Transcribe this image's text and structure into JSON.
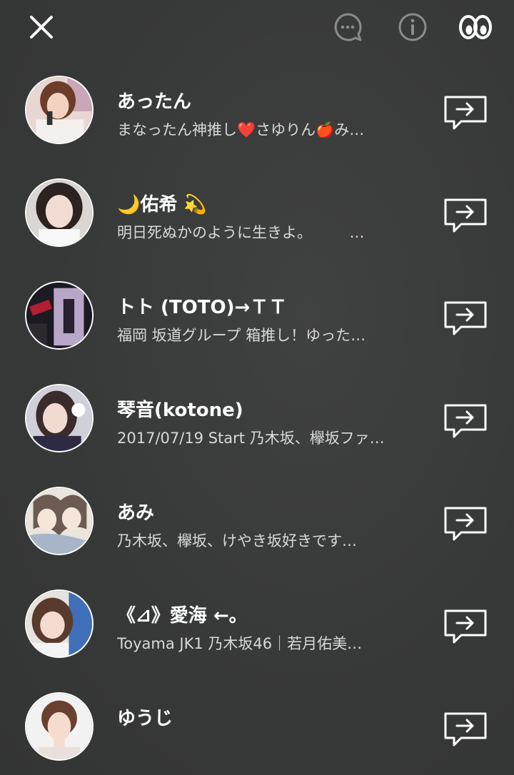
{
  "topbar": {
    "icons": [
      "close-icon",
      "chat-bubble-icon",
      "info-icon",
      "eyes-icon"
    ]
  },
  "friends": [
    {
      "name": "あったん",
      "status": "まなったん神推し❤️さゆりん🍎み…",
      "avatar": "avatar-1"
    },
    {
      "name": "🌙佑希 💫",
      "status": "明日死ぬかのように生きよ。　　　…",
      "avatar": "avatar-2"
    },
    {
      "name": "トト (TOTO)→ＴＴ",
      "status": "福岡 坂道グループ 箱推し！ゆった…",
      "avatar": "avatar-3"
    },
    {
      "name": "琴音(kotone)",
      "status": "2017/07/19 Start 乃木坂、欅坂ファ…",
      "avatar": "avatar-4"
    },
    {
      "name": "あみ",
      "status": "乃木坂、欅坂、けやき坂好きです…",
      "avatar": "avatar-5"
    },
    {
      "name": "《⊿》愛海 ←。",
      "status": "Toyama  JK1 乃木坂46｜若月佑美…",
      "avatar": "avatar-6"
    },
    {
      "name": "ゆうじ",
      "status": "",
      "avatar": "avatar-7"
    }
  ],
  "colors": {
    "background": "#3a3b3b",
    "text": "#ffffff",
    "subtext": "#d9d9d9",
    "icon_dim": "#8a8b8b"
  }
}
